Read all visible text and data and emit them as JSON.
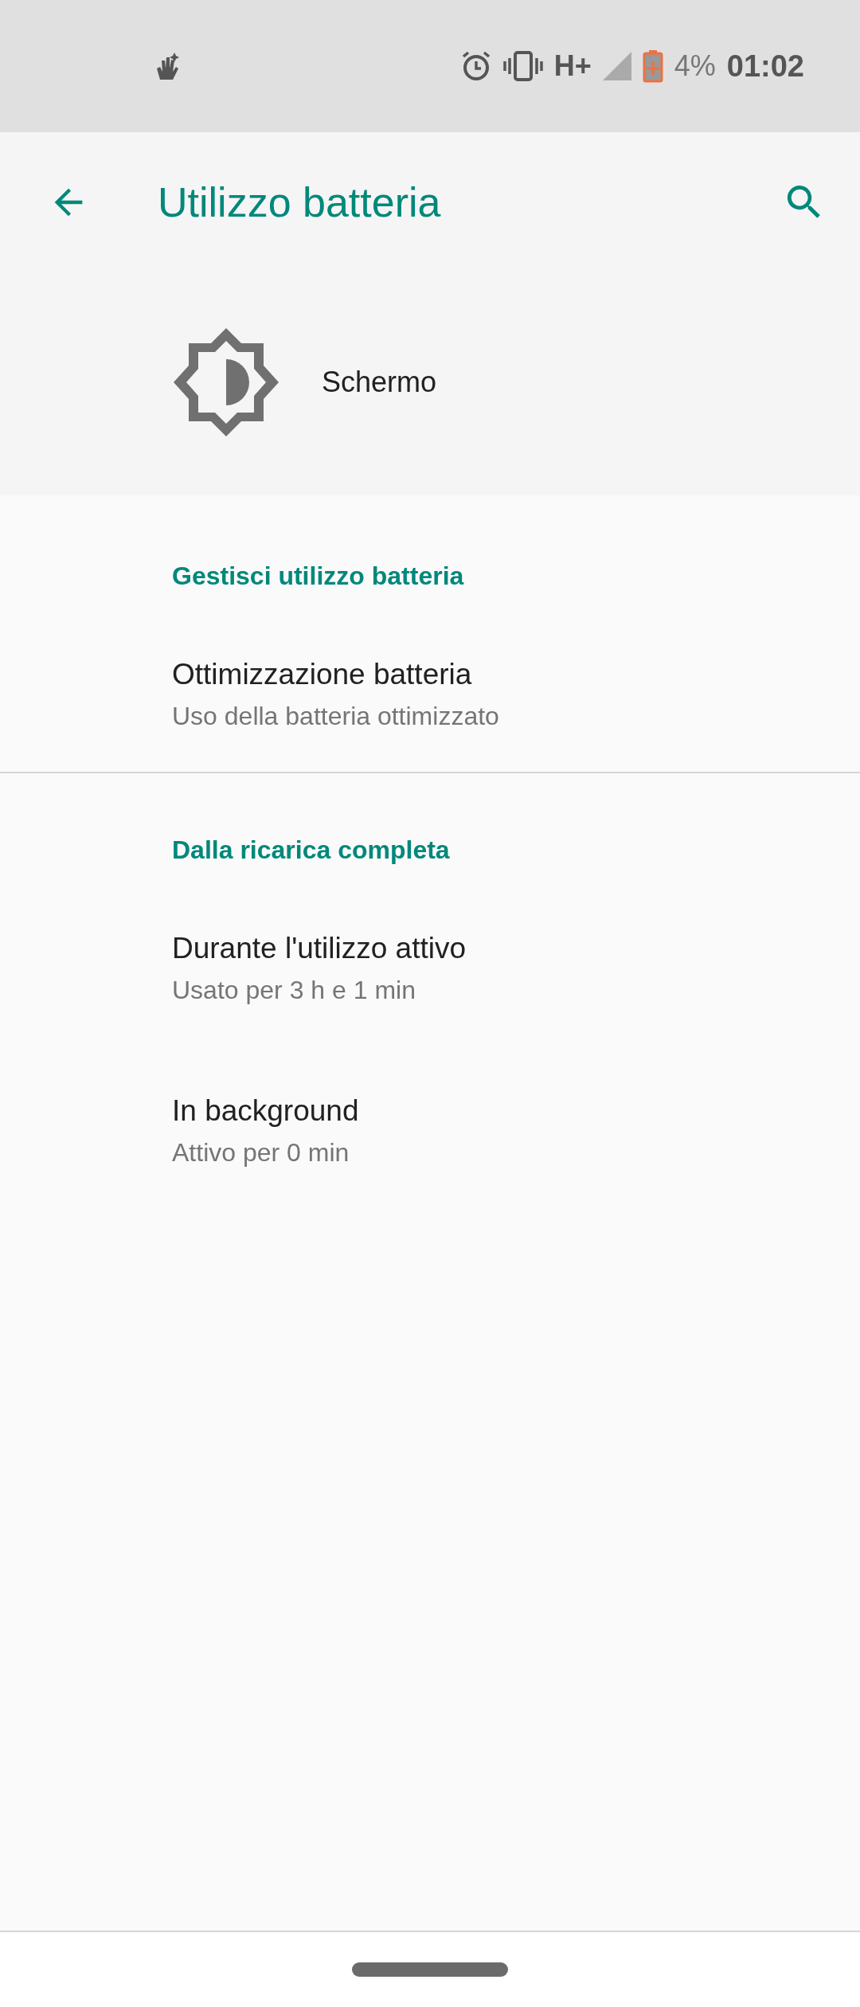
{
  "status_bar": {
    "network": "H+",
    "battery": "4%",
    "time": "01:02"
  },
  "toolbar": {
    "title": "Utilizzo batteria"
  },
  "app": {
    "name": "Schermo"
  },
  "sections": [
    {
      "title": "Gestisci utilizzo batteria",
      "items": [
        {
          "title": "Ottimizzazione batteria",
          "subtitle": "Uso della batteria ottimizzato"
        }
      ]
    },
    {
      "title": "Dalla ricarica completa",
      "items": [
        {
          "title": "Durante l'utilizzo attivo",
          "subtitle": "Usato per 3 h e 1 min"
        },
        {
          "title": "In background",
          "subtitle": "Attivo per 0 min"
        }
      ]
    }
  ]
}
